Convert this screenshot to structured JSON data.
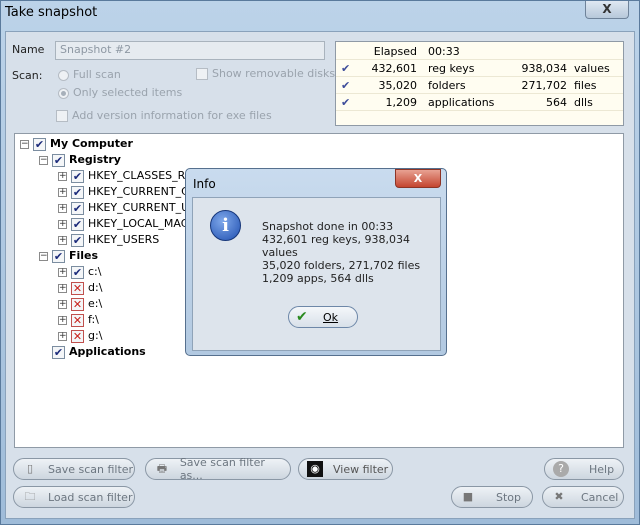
{
  "window": {
    "title": "Take snapshot",
    "close": "X"
  },
  "form": {
    "name_label": "Name",
    "name_value": "Snapshot #2",
    "scan_label": "Scan:",
    "full_scan": "Full scan",
    "only_selected": "Only selected items",
    "show_removable": "Show removable disks",
    "add_version": "Add version information for exe files"
  },
  "stats": {
    "elapsed_label": "Elapsed",
    "elapsed": "00:33",
    "rows": [
      {
        "count": "432,601",
        "label": "reg keys",
        "count2": "938,034",
        "label2": "values"
      },
      {
        "count": "35,020",
        "label": "folders",
        "count2": "271,702",
        "label2": "files"
      },
      {
        "count": "1,209",
        "label": "applications",
        "count2": "564",
        "label2": "dlls"
      }
    ]
  },
  "tree": [
    {
      "label": "My Computer",
      "state": "checked"
    },
    {
      "label": "Registry",
      "state": "checked"
    },
    {
      "label": "HKEY_CLASSES_R",
      "state": "checked"
    },
    {
      "label": "HKEY_CURRENT_C",
      "state": "checked"
    },
    {
      "label": "HKEY_CURRENT_US",
      "state": "checked"
    },
    {
      "label": "HKEY_LOCAL_MAC",
      "state": "checked"
    },
    {
      "label": "HKEY_USERS",
      "state": "checked"
    },
    {
      "label": "Files",
      "state": "checked"
    },
    {
      "label": "c:\\",
      "state": "checked"
    },
    {
      "label": "d:\\",
      "state": "excluded"
    },
    {
      "label": "e:\\",
      "state": "excluded"
    },
    {
      "label": "f:\\",
      "state": "excluded"
    },
    {
      "label": "g:\\",
      "state": "excluded"
    },
    {
      "label": "Applications",
      "state": "checked"
    }
  ],
  "buttons": {
    "save_filter": "Save scan filter",
    "save_filter_as": "Save scan filter as...",
    "view_filter": "View filter",
    "load_filter": "Load scan filter",
    "help": "Help",
    "stop": "Stop",
    "cancel": "Cancel"
  },
  "dialog": {
    "title": "Info",
    "close": "X",
    "lines": [
      "Snapshot done in 00:33",
      "432,601 reg keys, 938,034 values",
      "35,020 folders, 271,702 files",
      "1,209 apps, 564 dlls"
    ],
    "ok": "Ok"
  }
}
